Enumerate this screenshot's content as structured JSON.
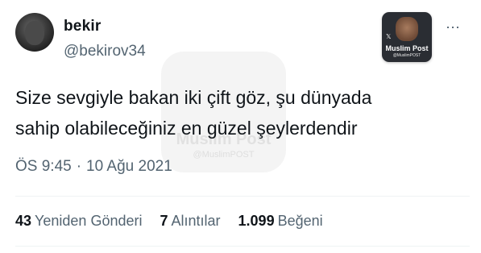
{
  "author": {
    "display_name": "bekir",
    "handle": "@bekirov34"
  },
  "badge": {
    "name": "Muslim Post",
    "handle": "@MuslimPOST",
    "x_mark": "𝕏"
  },
  "more_icon": "⋯",
  "tweet": {
    "lines": [
      "Size sevgiyle bakan iki çift göz, şu dünyada",
      "sahip olabileceğiniz en güzel şeylerdendir"
    ]
  },
  "meta": {
    "time": "ÖS 9:45",
    "separator": "·",
    "date": "10 Ağu 2021"
  },
  "stats": {
    "retweets_count": "43",
    "retweets_label": "Yeniden Gönderi",
    "quotes_count": "7",
    "quotes_label": "Alıntılar",
    "likes_count": "1.099",
    "likes_label": "Beğeni"
  },
  "watermark": {
    "title": "Muslim Post",
    "handle": "@MuslimPOST"
  }
}
